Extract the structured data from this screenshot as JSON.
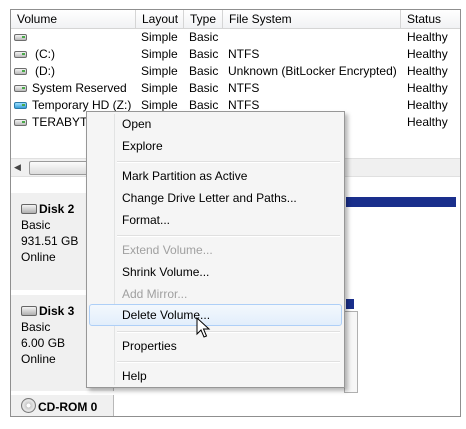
{
  "columns": [
    "Volume",
    "Layout",
    "Type",
    "File System",
    "Status"
  ],
  "volumes": [
    {
      "name": "",
      "layout": "Simple",
      "type": "Basic",
      "fs": "",
      "status": "Healthy"
    },
    {
      "name": "(C:)",
      "layout": "Simple",
      "type": "Basic",
      "fs": "NTFS",
      "status": "Healthy"
    },
    {
      "name": "(D:)",
      "layout": "Simple",
      "type": "Basic",
      "fs": "Unknown (BitLocker Encrypted)",
      "status": "Healthy"
    },
    {
      "name": "System Reserved",
      "layout": "Simple",
      "type": "Basic",
      "fs": "NTFS",
      "status": "Healthy"
    },
    {
      "name": "Temporary HD (Z:)",
      "layout": "Simple",
      "type": "Basic",
      "fs": "NTFS",
      "status": "Healthy"
    },
    {
      "name": "TERABYTE",
      "layout": "",
      "type": "",
      "fs": "",
      "status": "Healthy"
    }
  ],
  "disks": [
    {
      "name": "Disk 2",
      "type": "Basic",
      "size": "931.51 GB",
      "state": "Online"
    },
    {
      "name": "Disk 3",
      "type": "Basic",
      "size": "6.00 GB",
      "state": "Online"
    },
    {
      "name": "CD-ROM 0"
    }
  ],
  "menu": {
    "open": "Open",
    "explore": "Explore",
    "mark_active": "Mark Partition as Active",
    "change_letter": "Change Drive Letter and Paths...",
    "format": "Format...",
    "extend": "Extend Volume...",
    "shrink": "Shrink Volume...",
    "add_mirror": "Add Mirror...",
    "delete": "Delete Volume...",
    "properties": "Properties",
    "help": "Help"
  },
  "colors": {
    "partition_bar": "#1a2f8c",
    "hover": "#e2eefb"
  },
  "icons": {
    "drive": "drive-icon",
    "vhd": "vhd-drive-icon",
    "cdrom": "cdrom-icon",
    "scroll_left": "arrow-left-icon"
  }
}
